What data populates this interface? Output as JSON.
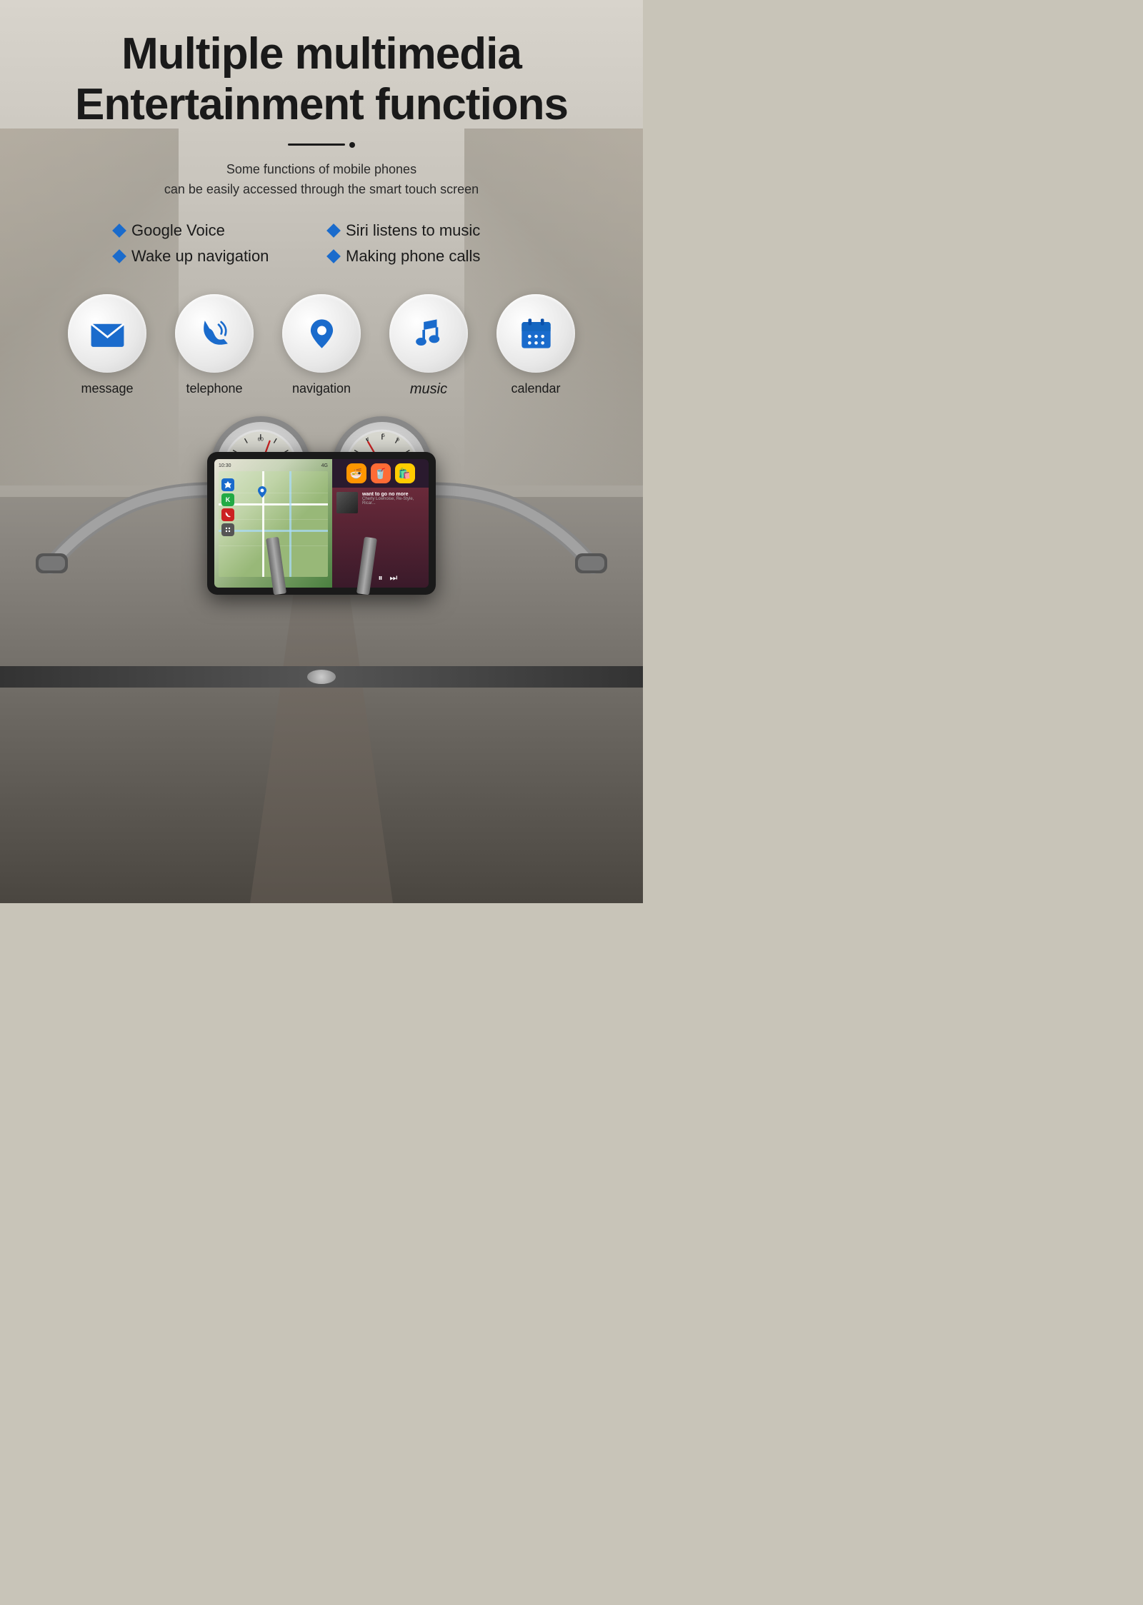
{
  "hero": {
    "title_line1": "Multiple multimedia",
    "title_line2": "Entertainment functions",
    "divider": true,
    "subtitle_line1": "Some functions of mobile phones",
    "subtitle_line2": "can be easily accessed through the smart touch screen"
  },
  "features": [
    {
      "id": "google-voice",
      "label": "Google Voice"
    },
    {
      "id": "siri-music",
      "label": "Siri listens to music"
    },
    {
      "id": "wake-navigation",
      "label": "Wake up navigation"
    },
    {
      "id": "phone-calls",
      "label": "Making phone calls"
    }
  ],
  "icons": [
    {
      "id": "message",
      "label": "message",
      "type": "envelope"
    },
    {
      "id": "telephone",
      "label": "telephone",
      "type": "phone"
    },
    {
      "id": "navigation",
      "label": "navigation",
      "type": "location"
    },
    {
      "id": "music",
      "label": "music",
      "type": "note",
      "style": "italic"
    },
    {
      "id": "calendar",
      "label": "calendar",
      "type": "calendar"
    }
  ],
  "screen": {
    "time": "10:30",
    "signal": "4G",
    "song_title": "want to go no more",
    "song_artist": "Cherly Lownoise, Re-Style, Ricar...",
    "app_icons": [
      "🍜",
      "🥤",
      "🛍️"
    ]
  },
  "colors": {
    "blue": "#1a6bcc",
    "dark": "#1a1a1a",
    "white": "#ffffff"
  }
}
